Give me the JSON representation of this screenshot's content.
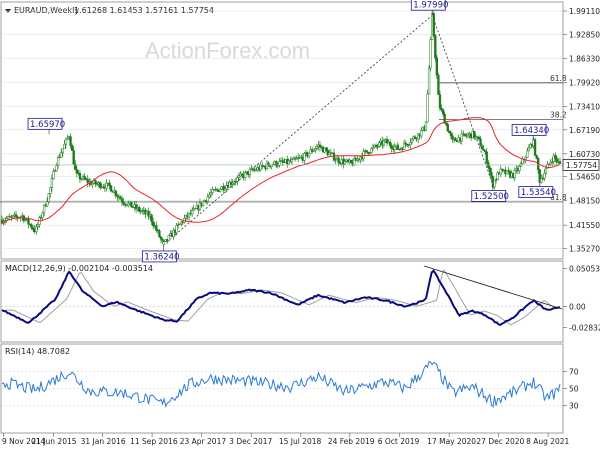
{
  "header": {
    "instrument": "EURAUD,Weekly",
    "ohlc": "1.61268 1.61453 1.57161 1.57754"
  },
  "watermark": "ActionForex.com",
  "colors": {
    "candle_up": "#ffffff",
    "candle_down": "#1a7a1a",
    "candle_outline": "#1a7a1a",
    "ma": "#e8242b",
    "macd": "#0a0a80",
    "signal": "#a0a0a0",
    "rsi": "#2b7bd6",
    "grid": "#dddddd",
    "label_box": "#1a1a8c"
  },
  "chart_data": [
    {
      "type": "candlestick",
      "title": "EURAUD,Weekly",
      "y_ticks": [
        "1.99110",
        "1.92850",
        "1.86330",
        "1.79920",
        "1.73410",
        "1.67190",
        "1.60730",
        "1.54650",
        "1.48150",
        "1.41550",
        "1.35270"
      ],
      "ylim": [
        1.33,
        2.01
      ],
      "current_price": "1.57754",
      "callouts": [
        {
          "label": "1.97990",
          "value": 1.9799,
          "date": "Mar 2020"
        },
        {
          "label": "1.65970",
          "value": 1.6597,
          "date": "Jun 2015"
        },
        {
          "label": "1.36240",
          "value": 1.3624,
          "date": "Nov 2016"
        },
        {
          "label": "1.64340",
          "value": 1.6434,
          "date": "Jun 2021"
        },
        {
          "label": "1.52500",
          "value": 1.525,
          "date": "Dec 2020"
        },
        {
          "label": "1.53540",
          "value": 1.5354,
          "date": "Jul 2021"
        }
      ],
      "fibonacci": [
        {
          "label": "61.8",
          "value": 1.798
        },
        {
          "label": "38.2",
          "value": 1.699
        },
        {
          "label": "61.8",
          "value": 1.478
        }
      ],
      "x_ticks": [
        "9 Nov 2014",
        "21 Jun 2015",
        "31 Jan 2016",
        "11 Sep 2016",
        "23 Apr 2017",
        "3 Dec 2017",
        "15 Jul 2018",
        "24 Feb 2019",
        "6 Oct 2019",
        "17 May 2020",
        "27 Dec 2020",
        "8 Aug 2021"
      ],
      "x_range": [
        "Nov 2014",
        "Oct 2021"
      ],
      "anchors": [
        {
          "date": "Nov 2014",
          "price": 1.43
        },
        {
          "date": "Feb 2015",
          "price": 1.44
        },
        {
          "date": "Apr 2015",
          "price": 1.4
        },
        {
          "date": "Jun 2015",
          "price": 1.5
        },
        {
          "date": "Jul 2015",
          "price": 1.58
        },
        {
          "date": "Sep 2015",
          "price": 1.6597
        },
        {
          "date": "Oct 2015",
          "price": 1.55
        },
        {
          "date": "Dec 2015",
          "price": 1.53
        },
        {
          "date": "Mar 2016",
          "price": 1.52
        },
        {
          "date": "May 2016",
          "price": 1.48
        },
        {
          "date": "Jul 2016",
          "price": 1.46
        },
        {
          "date": "Sep 2016",
          "price": 1.44
        },
        {
          "date": "Nov 2016",
          "price": 1.3624
        },
        {
          "date": "Feb 2017",
          "price": 1.43
        },
        {
          "date": "Apr 2017",
          "price": 1.46
        },
        {
          "date": "Jun 2017",
          "price": 1.5
        },
        {
          "date": "Aug 2017",
          "price": 1.52
        },
        {
          "date": "Oct 2017",
          "price": 1.54
        },
        {
          "date": "Dec 2017",
          "price": 1.56
        },
        {
          "date": "Mar 2018",
          "price": 1.58
        },
        {
          "date": "Jun 2018",
          "price": 1.585
        },
        {
          "date": "Aug 2018",
          "price": 1.6
        },
        {
          "date": "Oct 2018",
          "price": 1.63
        },
        {
          "date": "Jan 2019",
          "price": 1.59
        },
        {
          "date": "Mar 2019",
          "price": 1.58
        },
        {
          "date": "May 2019",
          "price": 1.61
        },
        {
          "date": "Aug 2019",
          "price": 1.64
        },
        {
          "date": "Oct 2019",
          "price": 1.62
        },
        {
          "date": "Jan 2020",
          "price": 1.66
        },
        {
          "date": "Feb 2020",
          "price": 1.68
        },
        {
          "date": "Mar 2020",
          "price": 1.9799
        },
        {
          "date": "Apr 2020",
          "price": 1.74
        },
        {
          "date": "Jun 2020",
          "price": 1.64
        },
        {
          "date": "Jul 2020",
          "price": 1.65
        },
        {
          "date": "Sep 2020",
          "price": 1.66
        },
        {
          "date": "Oct 2020",
          "price": 1.64
        },
        {
          "date": "Nov 2020",
          "price": 1.6
        },
        {
          "date": "Dec 2020",
          "price": 1.525
        },
        {
          "date": "Jan 2021",
          "price": 1.56
        },
        {
          "date": "Mar 2021",
          "price": 1.55
        },
        {
          "date": "Apr 2021",
          "price": 1.57
        },
        {
          "date": "Jun 2021",
          "price": 1.6434
        },
        {
          "date": "Jul 2021",
          "price": 1.5354
        },
        {
          "date": "Sep 2021",
          "price": 1.6
        },
        {
          "date": "Oct 2021",
          "price": 1.5775
        }
      ]
    },
    {
      "type": "line",
      "title": "MACD(12,26,9) -0.002104 -0.003514",
      "y_ticks": [
        "0.05053",
        "0.00",
        "-0.02832"
      ],
      "ylim": [
        -0.045,
        0.058
      ],
      "series": [
        {
          "name": "MACD"
        },
        {
          "name": "Signal"
        }
      ],
      "anchors": [
        {
          "date": "Nov 2014",
          "value": -0.005
        },
        {
          "date": "Mar 2015",
          "value": -0.022
        },
        {
          "date": "Jul 2015",
          "value": 0.01
        },
        {
          "date": "Sep 2015",
          "value": 0.047
        },
        {
          "date": "Nov 2015",
          "value": 0.02
        },
        {
          "date": "Feb 2016",
          "value": 0.0
        },
        {
          "date": "Apr 2016",
          "value": 0.006
        },
        {
          "date": "Jul 2016",
          "value": -0.005
        },
        {
          "date": "Nov 2016",
          "value": -0.018
        },
        {
          "date": "Jan 2017",
          "value": -0.02
        },
        {
          "date": "Apr 2017",
          "value": 0.01
        },
        {
          "date": "Jun 2017",
          "value": 0.018
        },
        {
          "date": "Sep 2017",
          "value": 0.017
        },
        {
          "date": "Dec 2017",
          "value": 0.022
        },
        {
          "date": "Mar 2018",
          "value": 0.018
        },
        {
          "date": "Jul 2018",
          "value": 0.002
        },
        {
          "date": "Oct 2018",
          "value": 0.015
        },
        {
          "date": "Feb 2019",
          "value": 0.005
        },
        {
          "date": "May 2019",
          "value": 0.012
        },
        {
          "date": "Aug 2019",
          "value": 0.008
        },
        {
          "date": "Nov 2019",
          "value": 0.0
        },
        {
          "date": "Feb 2020",
          "value": 0.008
        },
        {
          "date": "Mar 2020",
          "value": 0.05
        },
        {
          "date": "May 2020",
          "value": 0.02
        },
        {
          "date": "Jul 2020",
          "value": -0.012
        },
        {
          "date": "Sep 2020",
          "value": -0.006
        },
        {
          "date": "Nov 2020",
          "value": -0.012
        },
        {
          "date": "Jan 2021",
          "value": -0.025
        },
        {
          "date": "Mar 2021",
          "value": -0.015
        },
        {
          "date": "Jun 2021",
          "value": 0.008
        },
        {
          "date": "Aug 2021",
          "value": -0.005
        },
        {
          "date": "Oct 2021",
          "value": -0.002
        }
      ]
    },
    {
      "type": "line",
      "title": "RSI(14) 48.7082",
      "y_ticks": [
        "70",
        "50",
        "30"
      ],
      "ylim": [
        0,
        100
      ],
      "series": [
        {
          "name": "RSI"
        }
      ],
      "anchors": [
        {
          "date": "Nov 2014",
          "value": 58
        },
        {
          "date": "Apr 2015",
          "value": 48
        },
        {
          "date": "Sep 2015",
          "value": 70
        },
        {
          "date": "Dec 2015",
          "value": 47
        },
        {
          "date": "May 2016",
          "value": 45
        },
        {
          "date": "Nov 2016",
          "value": 32
        },
        {
          "date": "Mar 2017",
          "value": 55
        },
        {
          "date": "Jun 2017",
          "value": 62
        },
        {
          "date": "Dec 2017",
          "value": 58
        },
        {
          "date": "Jun 2018",
          "value": 52
        },
        {
          "date": "Oct 2018",
          "value": 64
        },
        {
          "date": "Feb 2019",
          "value": 46
        },
        {
          "date": "Aug 2019",
          "value": 58
        },
        {
          "date": "Nov 2019",
          "value": 50
        },
        {
          "date": "Mar 2020",
          "value": 80
        },
        {
          "date": "Jun 2020",
          "value": 45
        },
        {
          "date": "Sep 2020",
          "value": 52
        },
        {
          "date": "Dec 2020",
          "value": 35
        },
        {
          "date": "Mar 2021",
          "value": 45
        },
        {
          "date": "Jun 2021",
          "value": 58
        },
        {
          "date": "Aug 2021",
          "value": 38
        },
        {
          "date": "Oct 2021",
          "value": 49
        }
      ]
    }
  ]
}
